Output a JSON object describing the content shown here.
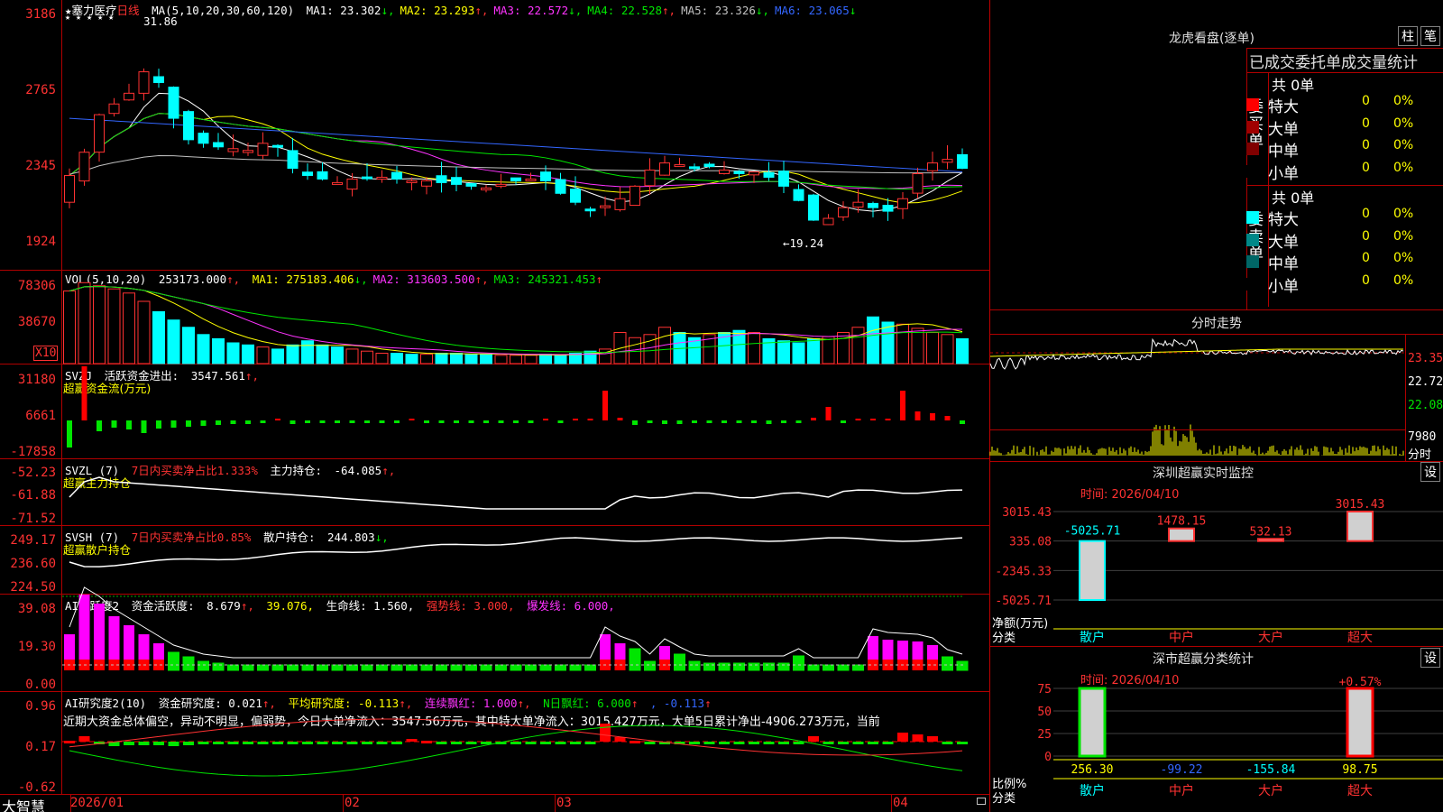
{
  "kline": {
    "title": "★塞力医疗",
    "period": "日线",
    "stars": "★ ★ ★ ★ ★",
    "ma_label": "MA(5,10,20,30,60,120)",
    "ma": [
      {
        "name": "MA1:",
        "value": "23.302",
        "arrow": "↓",
        "color": "#ffffff"
      },
      {
        "name": "MA2:",
        "value": "23.293",
        "arrow": "↑",
        "color": "#ffff00"
      },
      {
        "name": "MA3:",
        "value": "22.572",
        "arrow": "↓",
        "color": "#ff33ff"
      },
      {
        "name": "MA4:",
        "value": "22.528",
        "arrow": "↑",
        "color": "#00e600"
      },
      {
        "name": "MA5:",
        "value": "23.326",
        "arrow": "↓",
        "color": "#c0c0c0"
      },
      {
        "name": "MA6:",
        "value": "23.065",
        "arrow": "↓",
        "color": "#3366ff"
      }
    ],
    "y_labels": [
      "3186",
      "2765",
      "2345",
      "1924"
    ],
    "high_mark": "31.86",
    "low_mark": "←19.24"
  },
  "vol": {
    "label": "VOL(5,10,20)",
    "value": "253173.000",
    "ma": [
      {
        "name": "MA1:",
        "value": "275183.406",
        "arrow": "↓",
        "color": "#ffff00"
      },
      {
        "name": "MA2:",
        "value": "313603.500",
        "arrow": "↑",
        "color": "#ff33ff"
      },
      {
        "name": "MA3:",
        "value": "245321.453",
        "arrow": "↑",
        "color": "#00e600"
      }
    ],
    "y_labels": [
      "78306",
      "38670"
    ],
    "unit": "X10"
  },
  "svzj": {
    "label": "SVZJ",
    "desc": "活跃资金进出:",
    "value": "3547.561",
    "sub": "超赢资金流(万元)",
    "y_labels": [
      "31180",
      "6661",
      "-17858"
    ]
  },
  "svzl": {
    "label": "SVZL (7)",
    "note": "7日内买卖净占比1.333%",
    "desc": "主力持仓:",
    "value": "-64.085",
    "sub": "超赢主力持仓",
    "y_labels": [
      "-52.23",
      "-61.88",
      "-71.52"
    ]
  },
  "svsh": {
    "label": "SVSH (7)",
    "note": "7日内买卖净占比0.85%",
    "desc": "散户持仓:",
    "value": "244.803",
    "sub": "超赢散户持仓",
    "y_labels": [
      "249.17",
      "236.60",
      "224.50"
    ]
  },
  "ai1": {
    "label": "AI活跃度2",
    "desc": "资金活跃度:",
    "v1": "8.679",
    "v2": "39.076,",
    "life": "生命线: 1.560,",
    "strong": "强势线: 3.000,",
    "burst": "爆发线: 6.000,",
    "y_labels": [
      "39.08",
      "19.30",
      "0.00"
    ]
  },
  "ai2": {
    "label": "AI研究度2(10)",
    "desc": "资金研究度: 0.021",
    "avg": "平均研究度: -0.113",
    "streak": "连续飘红: 1.000",
    "nday": "N日飘红: 6.000",
    "last": ", -0.113",
    "comment": "近期大资金总体偏空，异动不明显，偏弱势，今日大单净流入：3547.56万元，其中特大单净流入：3015.427万元，大单5日累计净出-4906.273万元，当前",
    "y_labels": [
      "0.96",
      "0.17",
      "-0.62"
    ]
  },
  "xaxis": {
    "brand": "大智慧",
    "labels": [
      "2026/01",
      "02",
      "03",
      "04"
    ]
  },
  "right": {
    "dragon": {
      "title": "龙虎看盘(逐单)",
      "btn1": "柱",
      "btn2": "笔",
      "header": "已成交委托单成交量统计",
      "buy_label": "委买单",
      "sell_label": "委卖单",
      "buy_total": "共 0单",
      "sell_total": "共 0单",
      "rows": [
        {
          "name": "特大",
          "count": "0",
          "pct": "0%"
        },
        {
          "name": "大单",
          "count": "0",
          "pct": "0%"
        },
        {
          "name": "中单",
          "count": "0",
          "pct": "0%"
        },
        {
          "name": "小单",
          "count": "0",
          "pct": "0%"
        }
      ]
    },
    "intraday": {
      "title": "分时走势",
      "y_labels": [
        "23.35",
        "22.72",
        "22.08"
      ],
      "vol_label": "7980",
      "vol_unit": "分时"
    },
    "sz_monitor": {
      "title": "深圳超赢实时监控",
      "btn": "设",
      "time": "时间: 2026/04/10",
      "y_labels": [
        "3015.43",
        "335.08",
        "-2345.33",
        "-5025.71"
      ],
      "y_title": "净额(万元)",
      "x_title": "分类",
      "bars": [
        {
          "name": "散户",
          "value": "-5025.71",
          "v": -5025.71
        },
        {
          "name": "中户",
          "value": "1478.15",
          "v": 1478.15
        },
        {
          "name": "大户",
          "value": "532.13",
          "v": 532.13
        },
        {
          "name": "超大",
          "value": "3015.43",
          "v": 3015.43
        }
      ]
    },
    "sz_stats": {
      "title": "深市超赢分类统计",
      "btn": "设",
      "time": "时间: 2026/04/10",
      "y_labels": [
        "75",
        "50",
        "25",
        "0"
      ],
      "y_title": "比例%",
      "x_title": "分类",
      "top_label": "+0.57%",
      "values": [
        "256.30",
        "-99.22",
        "-155.84",
        "98.75"
      ],
      "cats": [
        "散户",
        "中户",
        "大户",
        "超大"
      ]
    }
  }
}
